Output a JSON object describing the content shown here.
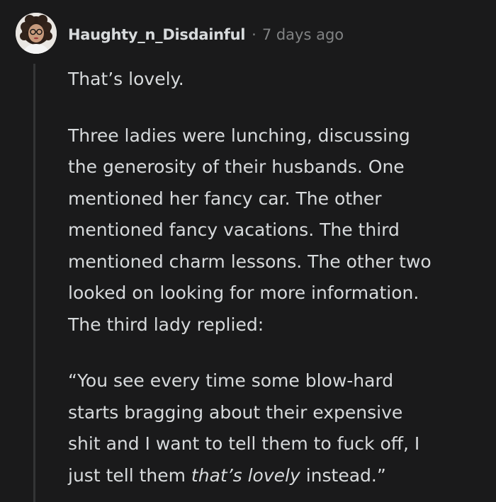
{
  "comment": {
    "author": "Haughty_n_Disdainful",
    "separator": "·",
    "timestamp": "7 days ago",
    "avatar": "avatar-image",
    "paragraphs": {
      "p1": "That’s lovely.",
      "p2_lines": [
        "Three ladies were lunching, discussing",
        "the generosity of their husbands. One",
        "mentioned her fancy car. The other",
        "mentioned fancy vacations. The third",
        "mentioned charm lessons. The other two",
        "looked on looking for more information.",
        "The third lady replied:"
      ],
      "p3_lines": [
        "“You see every time some blow-hard",
        "starts bragging about their expensive",
        "shit and I want to tell them to fuck off, I"
      ],
      "p3_last_prefix": "just tell them ",
      "p3_last_italic": "that’s lovely",
      "p3_last_suffix": " instead.”"
    }
  },
  "colors": {
    "background": "#1a1a1b",
    "text": "#d7dadc",
    "meta": "#818384",
    "thread_line": "#343536"
  }
}
